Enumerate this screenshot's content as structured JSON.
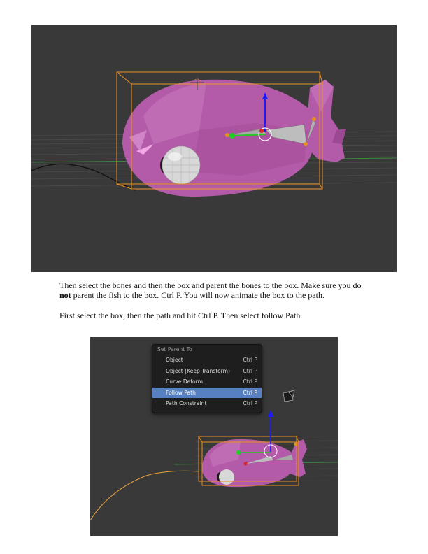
{
  "paragraphs": {
    "p1_part1": "Then select the bones and then the box and parent the bones to the box. Make sure you do",
    "p1_bold": "not",
    "p1_part2": " parent the fish to the box. Ctrl P. You will now animate the box to the path.",
    "p2": "First select the box, then the path and hit Ctrl P. Then select follow Path."
  },
  "parent_menu": {
    "title": "Set Parent To",
    "items": [
      {
        "label": "Object",
        "shortcut": "Ctrl P"
      },
      {
        "label": "Object (Keep Transform)",
        "shortcut": "Ctrl P"
      },
      {
        "label": "Curve Deform",
        "shortcut": "Ctrl P"
      },
      {
        "label": "Follow Path",
        "shortcut": "Ctrl P",
        "highlighted": true
      },
      {
        "label": "Path Constraint",
        "shortcut": "Ctrl P"
      }
    ]
  },
  "colors": {
    "viewport_bg": "#393939",
    "fish_body": "#b35aa8",
    "selection_box": "#e8901e",
    "menu_bg": "#1e1e1e",
    "menu_highlight": "#5680c2",
    "z_axis": "#1a1aff",
    "y_axis": "#22cc22"
  }
}
